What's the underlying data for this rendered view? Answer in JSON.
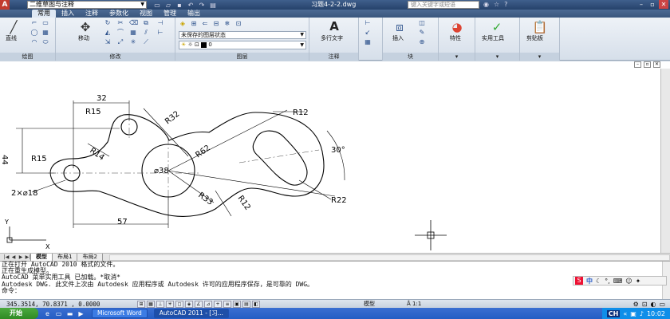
{
  "titlebar": {
    "logo": "A",
    "workspace": "二维草图与注释",
    "doc_title": "习题4-2-2.dwg",
    "search_placeholder": "键入关键字或短语"
  },
  "ribbon_tabs": [
    "常用",
    "插入",
    "注释",
    "参数化",
    "视图",
    "管理",
    "输出"
  ],
  "panels": {
    "draw": {
      "title": "绘图",
      "line_label": "直线"
    },
    "modify": {
      "title": "修改",
      "move_label": "移动"
    },
    "layers": {
      "title": "图层",
      "layer_state": "未保存的图层状态",
      "current_layer": "0"
    },
    "annotation": {
      "title": "注释",
      "mtext_label": "多行文字"
    },
    "block": {
      "title": "块",
      "insert_label": "插入"
    },
    "properties": {
      "label": "特性"
    },
    "utilities": {
      "label": "实用工具"
    },
    "clipboard": {
      "label": "剪贴板"
    }
  },
  "drawing": {
    "dims": {
      "d32": "32",
      "r15_top": "R15",
      "r32": "R32",
      "r12_top": "R12",
      "d44": "44",
      "r14": "R14",
      "r15_left": "R15",
      "d_38": "⌀38",
      "r62": "R62",
      "a30": "30°",
      "hole": "2×⌀18",
      "r33": "R33",
      "r12_bot": "R12",
      "r22": "R22",
      "d57": "57"
    },
    "axis_y": "Y",
    "axis_x": "X"
  },
  "layout_tabs": [
    "模型",
    "布局1",
    "布局2"
  ],
  "command_lines": [
    "正在打开 AutoCAD 2010 格式的文件。",
    "正在重生成模型。",
    "AutoCAD 菜单实用工具 已加载。*取消*",
    "Autodesk DWG.   此文件上次由 Autodesk 应用程序或 Autodesk 许可的应用程序保存，是可靠的 DWG。",
    "命令："
  ],
  "ime": {
    "s": "S",
    "lang": "中"
  },
  "status": {
    "coords": "345.3514, 70.8371 , 0.0000",
    "model": "模型",
    "scale": "1:1"
  },
  "taskbar": {
    "start": "开始",
    "tasks": [
      "Microsoft Word",
      "AutoCAD 2011 - [习..."
    ],
    "tray_ch": "CH",
    "time": "10:02"
  }
}
